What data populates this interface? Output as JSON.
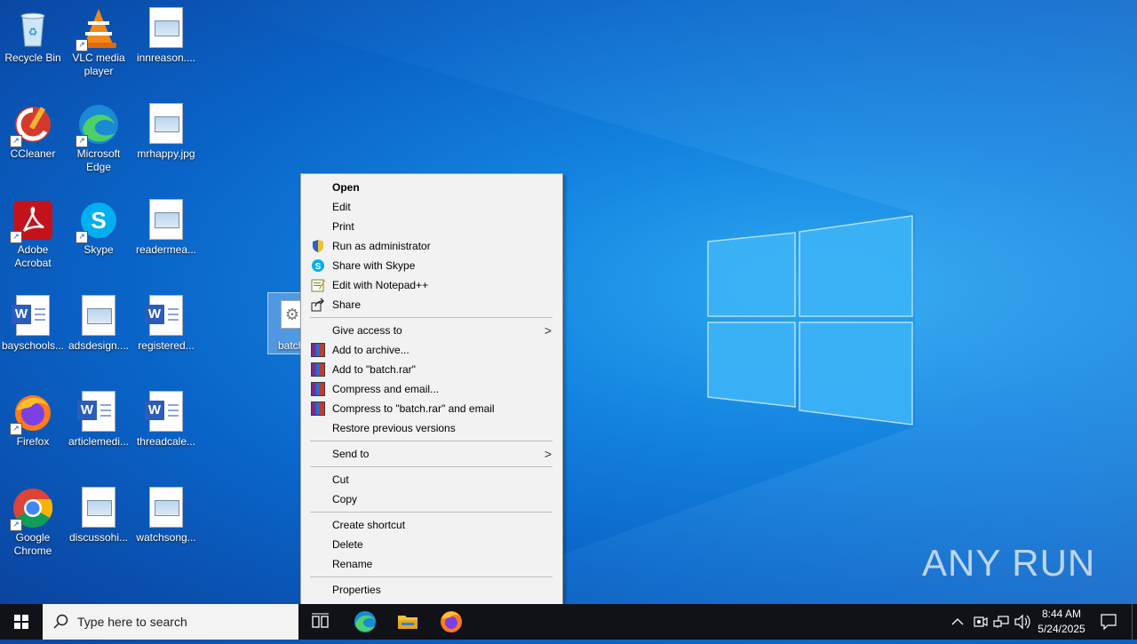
{
  "desktop": {
    "icons": [
      {
        "label": "Recycle Bin"
      },
      {
        "label": "VLC media player"
      },
      {
        "label": "innreason...."
      },
      {
        "label": "CCleaner"
      },
      {
        "label": "Microsoft Edge"
      },
      {
        "label": "mrhappy.jpg"
      },
      {
        "label": "Adobe Acrobat"
      },
      {
        "label": "Skype"
      },
      {
        "label": "readermea..."
      },
      {
        "label": "bayschools..."
      },
      {
        "label": "adsdesign...."
      },
      {
        "label": "registered..."
      },
      {
        "label": "Firefox"
      },
      {
        "label": "articlemedi..."
      },
      {
        "label": "threadcale..."
      },
      {
        "label": "Google Chrome"
      },
      {
        "label": "discussohi..."
      },
      {
        "label": "watchsong..."
      }
    ],
    "selected_file_label": "batch"
  },
  "context_menu": {
    "items": [
      {
        "label": "Open"
      },
      {
        "label": "Edit"
      },
      {
        "label": "Print"
      },
      {
        "label": "Run as administrator",
        "icon": "shield-icon"
      },
      {
        "label": "Share with Skype",
        "icon": "skype-icon"
      },
      {
        "label": "Edit with Notepad++",
        "icon": "notepadpp-icon"
      },
      {
        "label": "Share",
        "icon": "share-icon"
      },
      {
        "label": "Give access to"
      },
      {
        "label": "Add to archive...",
        "icon": "winrar-icon"
      },
      {
        "label": "Add to \"batch.rar\"",
        "icon": "winrar-icon"
      },
      {
        "label": "Compress and email...",
        "icon": "winrar-icon"
      },
      {
        "label": "Compress to \"batch.rar\" and email",
        "icon": "winrar-icon"
      },
      {
        "label": "Restore previous versions"
      },
      {
        "label": "Send to"
      },
      {
        "label": "Cut"
      },
      {
        "label": "Copy"
      },
      {
        "label": "Create shortcut"
      },
      {
        "label": "Delete"
      },
      {
        "label": "Rename"
      },
      {
        "label": "Properties"
      }
    ]
  },
  "taskbar": {
    "search_placeholder": "Type here to search",
    "time": "8:44 AM",
    "date": "5/24/2025"
  },
  "watermark": "ANY RUN",
  "colors": {
    "desktop_accent": "#1484e0",
    "taskbar_bg": "#101218",
    "menu_bg": "#f2f2f2"
  }
}
